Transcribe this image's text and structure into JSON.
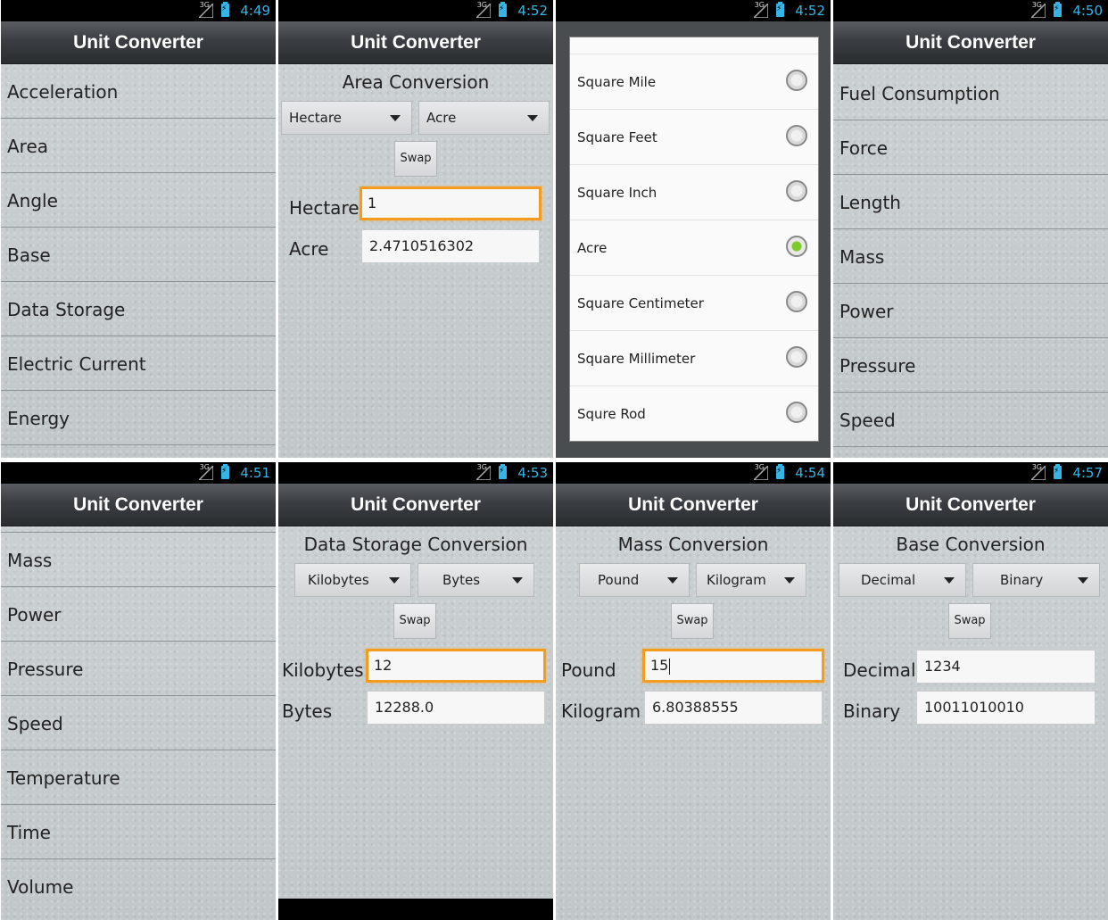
{
  "app_title": "Unit Converter",
  "status_network": "3G",
  "screens": {
    "s1": {
      "time": "4:49",
      "items": [
        "Acceleration",
        "Area",
        "Angle",
        "Base",
        "Data Storage",
        "Electric Current",
        "Energy"
      ]
    },
    "s2": {
      "time": "4:52",
      "heading": "Area Conversion",
      "from_unit": "Hectare",
      "to_unit": "Acre",
      "swap": "Swap",
      "from_label": "Hectare",
      "from_value": "1",
      "to_label": "Acre",
      "to_value": "2.4710516302"
    },
    "s3": {
      "time": "4:52",
      "options": [
        {
          "label": "Square Mile",
          "selected": false
        },
        {
          "label": "Square Feet",
          "selected": false
        },
        {
          "label": "Square Inch",
          "selected": false
        },
        {
          "label": "Acre",
          "selected": true
        },
        {
          "label": "Square Centimeter",
          "selected": false
        },
        {
          "label": "Square Millimeter",
          "selected": false
        },
        {
          "label": "Squre Rod",
          "selected": false
        }
      ]
    },
    "s4": {
      "time": "4:50",
      "items": [
        "Fuel Consumption",
        "Force",
        "Length",
        "Mass",
        "Power",
        "Pressure",
        "Speed"
      ]
    },
    "s5": {
      "time": "4:51",
      "items": [
        "Mass",
        "Power",
        "Pressure",
        "Speed",
        "Temperature",
        "Time",
        "Volume"
      ]
    },
    "s6": {
      "time": "4:53",
      "heading": "Data Storage Conversion",
      "from_unit": "Kilobytes",
      "to_unit": "Bytes",
      "swap": "Swap",
      "from_label": "Kilobytes",
      "from_value": "12",
      "to_label": "Bytes",
      "to_value": "12288.0"
    },
    "s7": {
      "time": "4:54",
      "heading": "Mass Conversion",
      "from_unit": "Pound",
      "to_unit": "Kilogram",
      "swap": "Swap",
      "from_label": "Pound",
      "from_value": "15",
      "to_label": "Kilogram",
      "to_value": "6.80388555"
    },
    "s8": {
      "time": "4:57",
      "heading": "Base Conversion",
      "from_unit": "Decimal",
      "to_unit": "Binary",
      "swap": "Swap",
      "from_label": "Decimal",
      "from_value": "1234",
      "to_label": "Binary",
      "to_value": "10011010010"
    }
  },
  "colors": {
    "accent": "#35b5e5",
    "focus": "#f39c1f",
    "radio_selected": "#7ccb2a"
  }
}
